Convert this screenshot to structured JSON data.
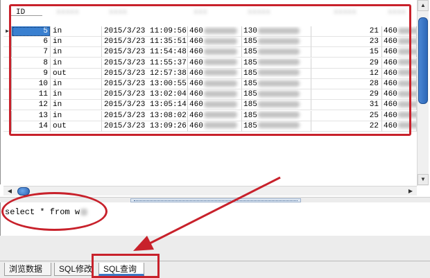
{
  "grid": {
    "columns": [
      "ID"
    ],
    "rows": [
      {
        "id": "5",
        "type": "in",
        "time": "2015/3/23  11:09:56",
        "p1": "460",
        "p2": "130",
        "num": "21",
        "last": "460",
        "selected": true
      },
      {
        "id": "6",
        "type": "in",
        "time": "2015/3/23  11:35:51",
        "p1": "460",
        "p2": "185",
        "num": "23",
        "last": "460"
      },
      {
        "id": "7",
        "type": "in",
        "time": "2015/3/23  11:54:48",
        "p1": "460",
        "p2": "185",
        "num": "15",
        "last": "460"
      },
      {
        "id": "8",
        "type": "in",
        "time": "2015/3/23  11:55:37",
        "p1": "460",
        "p2": "185",
        "num": "29",
        "last": "460"
      },
      {
        "id": "9",
        "type": "out",
        "time": "2015/3/23  12:57:38",
        "p1": "460",
        "p2": "185",
        "num": "12",
        "last": "460"
      },
      {
        "id": "10",
        "type": "in",
        "time": "2015/3/23  13:00:55",
        "p1": "460",
        "p2": "185",
        "num": "28",
        "last": "460"
      },
      {
        "id": "11",
        "type": "in",
        "time": "2015/3/23  13:02:04",
        "p1": "460",
        "p2": "185",
        "num": "29",
        "last": "460"
      },
      {
        "id": "12",
        "type": "in",
        "time": "2015/3/23  13:05:14",
        "p1": "460",
        "p2": "185",
        "num": "31",
        "last": "460"
      },
      {
        "id": "13",
        "type": "in",
        "time": "2015/3/23  13:08:02",
        "p1": "460",
        "p2": "185",
        "num": "25",
        "last": "460"
      },
      {
        "id": "14",
        "type": "out",
        "time": "2015/3/23  13:09:26",
        "p1": "460",
        "p2": "185",
        "num": "22",
        "last": "460"
      }
    ],
    "current_row_marker": "▶"
  },
  "editor": {
    "sql": "select * from w"
  },
  "tabs": [
    {
      "label": "浏览数据"
    },
    {
      "label": "SQL修改"
    },
    {
      "label": "SQL查询",
      "active": true
    }
  ],
  "colors": {
    "annotation": "#c8212b",
    "selection": "#3a80d0",
    "active_tab_underline": "#3b78c4"
  },
  "icons": {
    "scroll_up": "arrow-up-icon",
    "scroll_down": "arrow-down-icon",
    "scroll_left": "arrow-left-icon",
    "scroll_right": "arrow-right-icon"
  }
}
